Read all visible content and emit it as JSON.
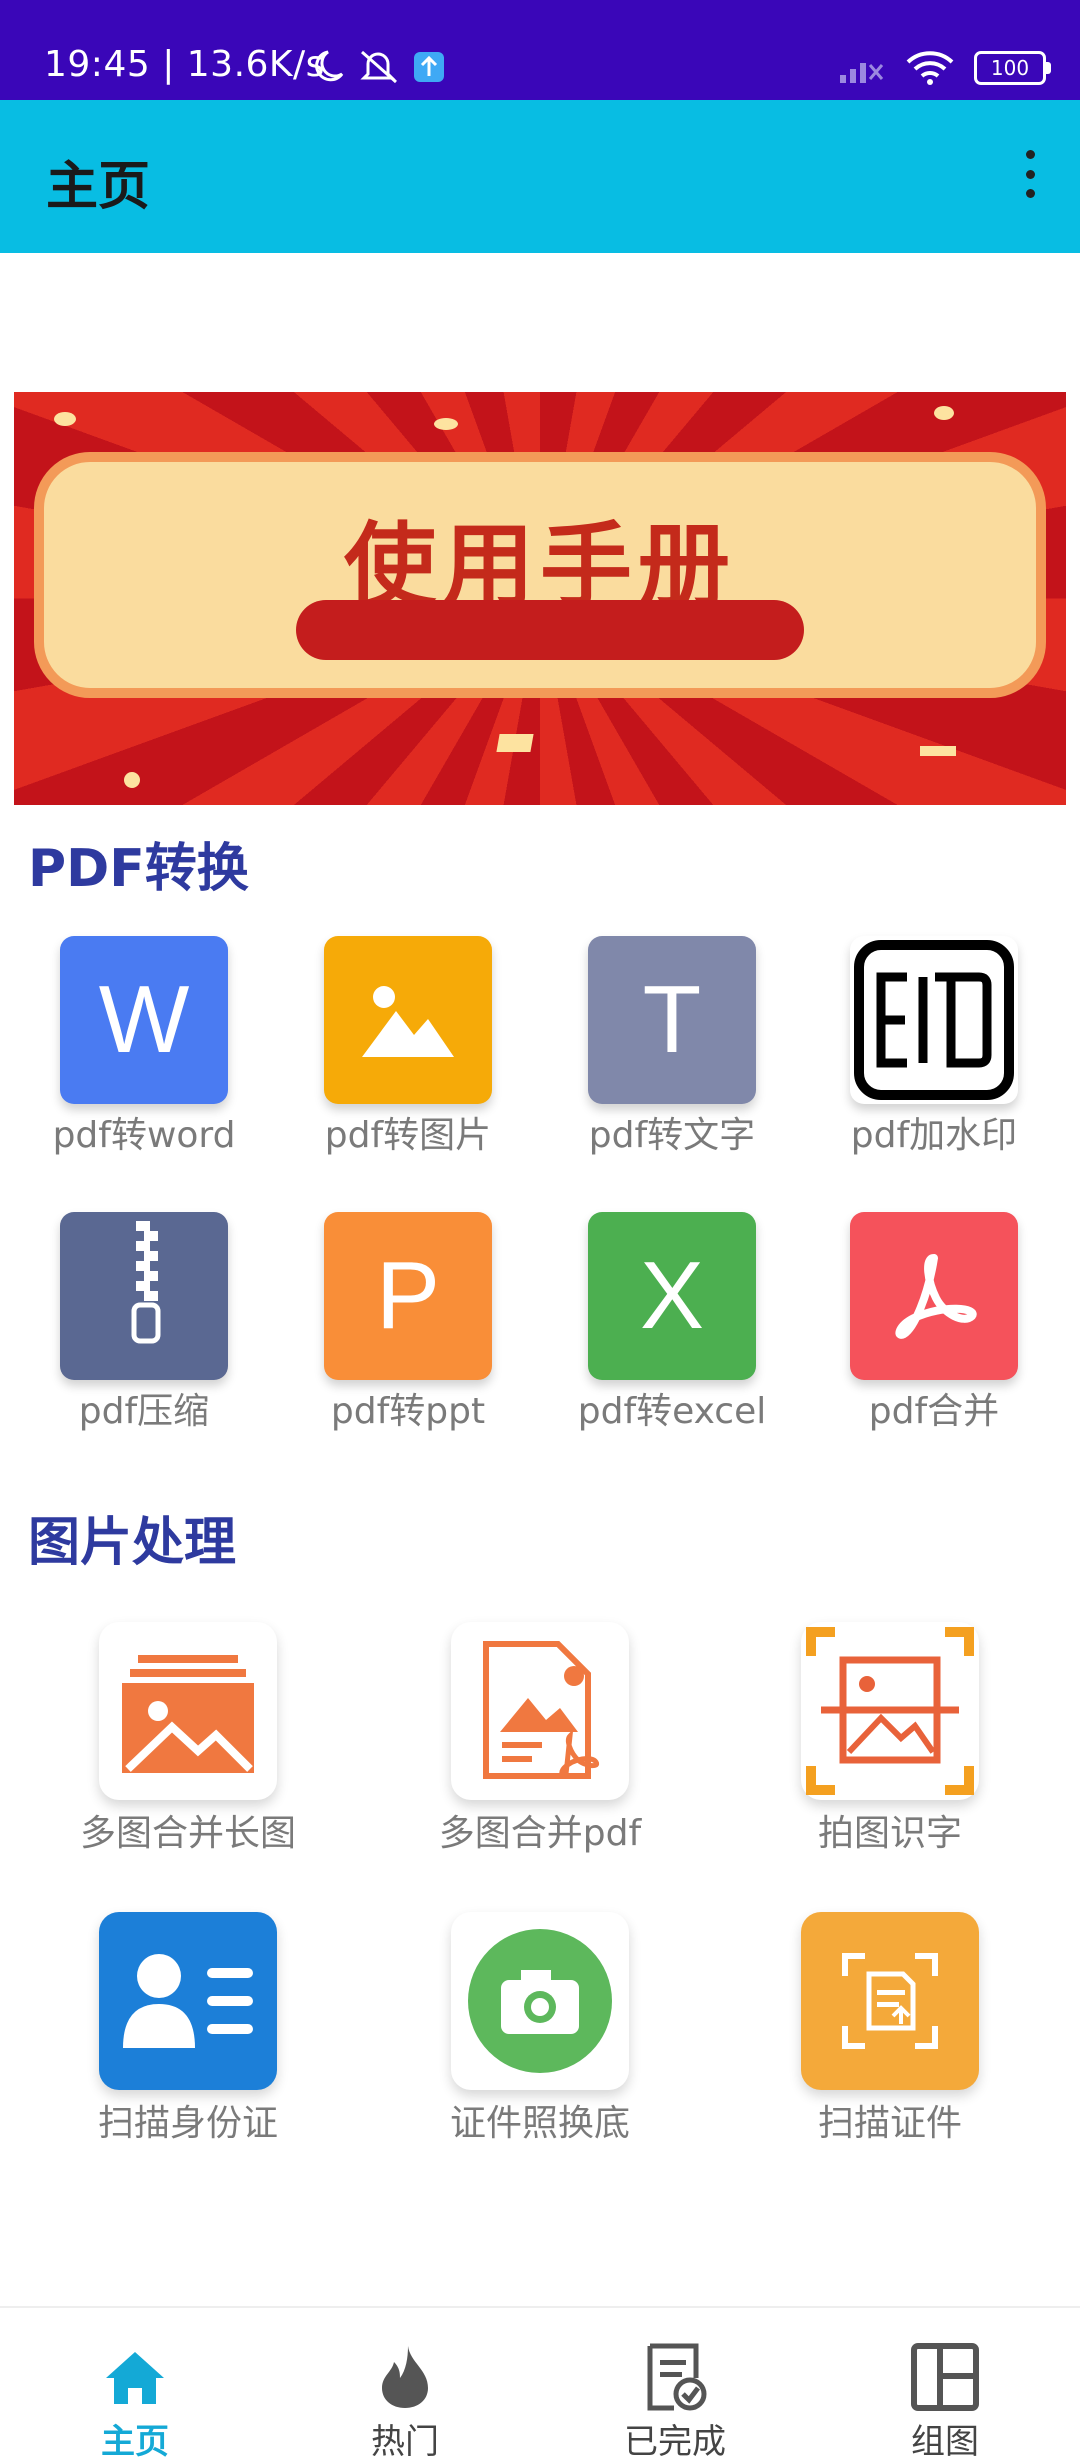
{
  "status_bar": {
    "time_speed": "19:45 | 13.6K/s",
    "battery": "100"
  },
  "app_bar": {
    "title": "主页"
  },
  "banner": {
    "title": "使用手册"
  },
  "sections": {
    "pdf": {
      "title": "PDF转换",
      "tools": [
        {
          "label": "pdf转word",
          "letter": "W",
          "color": "#4a7bf2"
        },
        {
          "label": "pdf转图片",
          "icon": "image-icon",
          "color": "#f6aa08"
        },
        {
          "label": "pdf转文字",
          "letter": "T",
          "color": "#8088aa"
        },
        {
          "label": "pdf加水印",
          "icon": "stamp-icon",
          "color": "#ffffff"
        },
        {
          "label": "pdf压缩",
          "icon": "zip-icon",
          "color": "#5a6892"
        },
        {
          "label": "pdf转ppt",
          "letter": "P",
          "color": "#f98e38"
        },
        {
          "label": "pdf转excel",
          "letter": "X",
          "color": "#4caf50"
        },
        {
          "label": "pdf合并",
          "icon": "acrobat-icon",
          "color": "#f5525b"
        }
      ]
    },
    "image": {
      "title": "图片处理",
      "tools": [
        {
          "label": "多图合并长图",
          "icon": "stacked-images-icon"
        },
        {
          "label": "多图合并pdf",
          "icon": "image-to-pdf-icon"
        },
        {
          "label": "拍图识字",
          "icon": "scan-image-icon"
        },
        {
          "label": "扫描身份证",
          "icon": "id-card-icon"
        },
        {
          "label": "证件照换底",
          "icon": "camera-icon"
        },
        {
          "label": "扫描证件",
          "icon": "scan-document-icon"
        }
      ]
    }
  },
  "bottom_nav": {
    "items": [
      {
        "label": "主页",
        "icon": "home-icon",
        "active": true
      },
      {
        "label": "热门",
        "icon": "flame-icon"
      },
      {
        "label": "已完成",
        "icon": "completed-doc-icon"
      },
      {
        "label": "组图",
        "icon": "grid-layout-icon"
      }
    ]
  },
  "colors": {
    "status_bar": "#3a06b8",
    "app_bar": "#08bde3",
    "section_title": "#2e3a9f",
    "nav_active": "#14a9d6"
  }
}
